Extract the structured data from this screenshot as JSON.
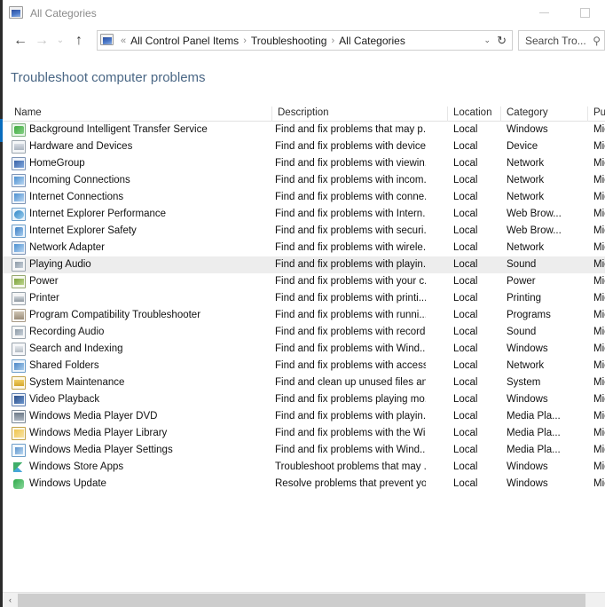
{
  "window": {
    "title": "All Categories",
    "app_icon": "control-panel-icon",
    "minimize_label": "–",
    "maximize_label": "□"
  },
  "navbar": {
    "back_icon": "←",
    "forward_icon": "→",
    "recent_icon": "⌄",
    "up_icon": "↑",
    "address_icon": "control-panel-icon",
    "overflow_chevron": "«",
    "breadcrumbs": [
      "All Control Panel Items",
      "Troubleshooting",
      "All Categories"
    ],
    "separator": "›",
    "dropdown_icon": "⌄",
    "refresh_icon": "↻"
  },
  "search": {
    "value": "Search Tro...",
    "icon": "⚲"
  },
  "heading": "Troubleshoot computer problems",
  "table": {
    "columns": [
      "Name",
      "Description",
      "Location",
      "Category",
      "Publis"
    ],
    "rows": [
      {
        "name": "Background Intelligent Transfer Service",
        "icon": "ic-bits",
        "description": "Find and fix problems that may p...",
        "location": "Local",
        "category": "Windows",
        "publisher": "Micros",
        "selected": false
      },
      {
        "name": "Hardware and Devices",
        "icon": "ic-hw",
        "description": "Find and fix problems with device...",
        "location": "Local",
        "category": "Device",
        "publisher": "Micros",
        "selected": false
      },
      {
        "name": "HomeGroup",
        "icon": "ic-net",
        "description": "Find and fix problems with viewin...",
        "location": "Local",
        "category": "Network",
        "publisher": "Micros",
        "selected": false
      },
      {
        "name": "Incoming Connections",
        "icon": "ic-net2",
        "description": "Find and fix problems with incom...",
        "location": "Local",
        "category": "Network",
        "publisher": "Micros",
        "selected": false
      },
      {
        "name": "Internet Connections",
        "icon": "ic-net2",
        "description": "Find and fix problems with conne...",
        "location": "Local",
        "category": "Network",
        "publisher": "Micros",
        "selected": false
      },
      {
        "name": "Internet Explorer Performance",
        "icon": "ic-ie",
        "description": "Find and fix problems with Intern...",
        "location": "Local",
        "category": "Web Brow...",
        "publisher": "Micros",
        "selected": false
      },
      {
        "name": "Internet Explorer Safety",
        "icon": "ic-ie2",
        "description": "Find and fix problems with securi...",
        "location": "Local",
        "category": "Web Brow...",
        "publisher": "Micros",
        "selected": false
      },
      {
        "name": "Network Adapter",
        "icon": "ic-net2",
        "description": "Find and fix problems with wirele...",
        "location": "Local",
        "category": "Network",
        "publisher": "Micros",
        "selected": false
      },
      {
        "name": "Playing Audio",
        "icon": "ic-audio",
        "description": "Find and fix problems with playin...",
        "location": "Local",
        "category": "Sound",
        "publisher": "Micros",
        "selected": true
      },
      {
        "name": "Power",
        "icon": "ic-power",
        "description": "Find and fix problems with your c...",
        "location": "Local",
        "category": "Power",
        "publisher": "Micros",
        "selected": false
      },
      {
        "name": "Printer",
        "icon": "ic-print",
        "description": "Find and fix problems with printi...",
        "location": "Local",
        "category": "Printing",
        "publisher": "Micros",
        "selected": false
      },
      {
        "name": "Program Compatibility Troubleshooter",
        "icon": "ic-prog",
        "description": "Find and fix problems with runni...",
        "location": "Local",
        "category": "Programs",
        "publisher": "Micros",
        "selected": false
      },
      {
        "name": "Recording Audio",
        "icon": "ic-audio",
        "description": "Find and fix problems with record...",
        "location": "Local",
        "category": "Sound",
        "publisher": "Micros",
        "selected": false
      },
      {
        "name": "Search and Indexing",
        "icon": "ic-search",
        "description": "Find and fix problems with Wind...",
        "location": "Local",
        "category": "Windows",
        "publisher": "Micros",
        "selected": false
      },
      {
        "name": "Shared Folders",
        "icon": "ic-folder",
        "description": "Find and fix problems with access...",
        "location": "Local",
        "category": "Network",
        "publisher": "Micros",
        "selected": false
      },
      {
        "name": "System Maintenance",
        "icon": "ic-sys",
        "description": "Find and clean up unused files an...",
        "location": "Local",
        "category": "System",
        "publisher": "Micros",
        "selected": false
      },
      {
        "name": "Video Playback",
        "icon": "ic-video",
        "description": "Find and fix problems playing mo...",
        "location": "Local",
        "category": "Windows",
        "publisher": "Micros",
        "selected": false
      },
      {
        "name": "Windows Media Player DVD",
        "icon": "ic-wmp",
        "description": "Find and fix problems with playin...",
        "location": "Local",
        "category": "Media Pla...",
        "publisher": "Micros",
        "selected": false
      },
      {
        "name": "Windows Media Player Library",
        "icon": "ic-wmpl",
        "description": "Find and fix problems with the Wi...",
        "location": "Local",
        "category": "Media Pla...",
        "publisher": "Micros",
        "selected": false
      },
      {
        "name": "Windows Media Player Settings",
        "icon": "ic-wmps",
        "description": "Find and fix problems with Wind...",
        "location": "Local",
        "category": "Media Pla...",
        "publisher": "Micros",
        "selected": false
      },
      {
        "name": "Windows Store Apps",
        "icon": "ic-store",
        "description": "Troubleshoot problems that may ...",
        "location": "Local",
        "category": "Windows",
        "publisher": "Micros",
        "selected": false
      },
      {
        "name": "Windows Update",
        "icon": "ic-upd",
        "description": "Resolve problems that prevent yo...",
        "location": "Local",
        "category": "Windows",
        "publisher": "Micros",
        "selected": false
      }
    ]
  },
  "scrollbar": {
    "left_arrow": "‹"
  },
  "colors": {
    "heading": "#4a6785",
    "selection": "#ededed",
    "accent": "#0a6cbd"
  }
}
